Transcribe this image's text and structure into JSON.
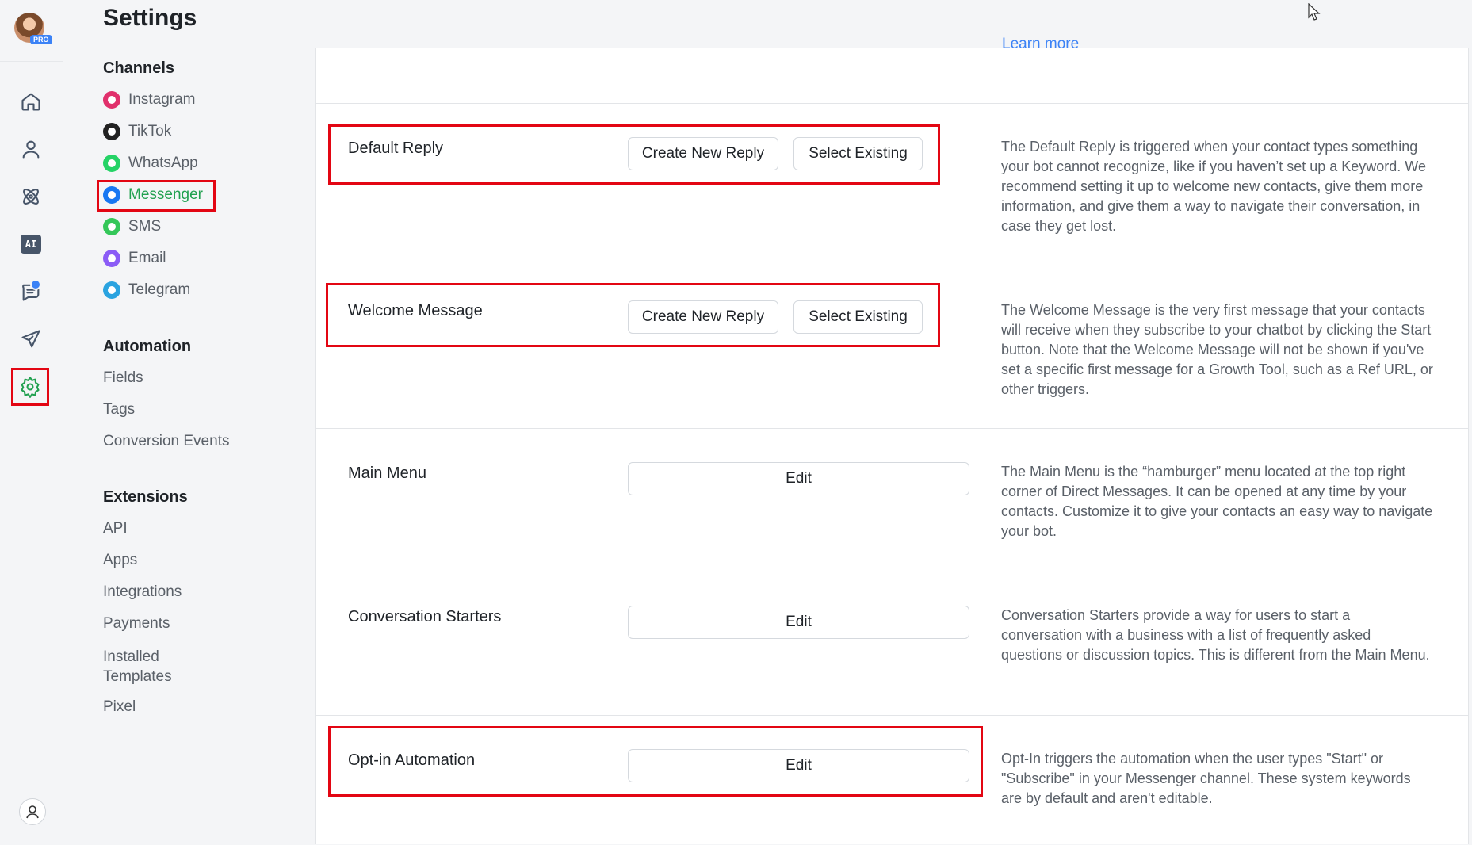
{
  "header": {
    "title": "Settings"
  },
  "rail": {
    "badge": "PRO",
    "ai_label": "AI",
    "items": [
      "home-icon",
      "contacts-icon",
      "automation-icon",
      "ai-icon",
      "chat-icon",
      "broadcast-icon",
      "settings-icon"
    ],
    "accent": "#22a150",
    "highlight": "#e30613"
  },
  "sidebar": {
    "channels_title": "Channels",
    "channels": [
      {
        "label": "Instagram",
        "color": "#e1306c"
      },
      {
        "label": "TikTok",
        "color": "#222222"
      },
      {
        "label": "WhatsApp",
        "color": "#25d366"
      },
      {
        "label": "Messenger",
        "color": "#1877f2",
        "active": true
      },
      {
        "label": "SMS",
        "color": "#34c759"
      },
      {
        "label": "Email",
        "color": "#8b5cf6"
      },
      {
        "label": "Telegram",
        "color": "#2aa3e0"
      }
    ],
    "automation_title": "Automation",
    "automation": [
      "Fields",
      "Tags",
      "Conversion Events"
    ],
    "extensions_title": "Extensions",
    "extensions": [
      "API",
      "Apps",
      "Integrations",
      "Payments",
      "Installed Templates",
      "Pixel"
    ]
  },
  "main": {
    "learn_more": "Learn more",
    "sections": [
      {
        "label": "Default Reply",
        "create_label": "Create New Reply",
        "select_label": "Select Existing",
        "desc": "The Default Reply is triggered when your contact types something your bot cannot recognize, like if you haven’t set up a Keyword. We recommend setting it up to welcome new contacts, give them more information, and give them a way to navigate their conversation, in case they get lost."
      },
      {
        "label": "Welcome Message",
        "create_label": "Create New Reply",
        "select_label": "Select Existing",
        "desc": "The Welcome Message is the very first message that your contacts will receive when they subscribe to your chatbot by clicking the Start button. Note that the Welcome Message will not be shown if you've set a specific first message for a Growth Tool, such as a Ref URL, or other triggers."
      },
      {
        "label": "Main Menu",
        "edit_label": "Edit",
        "desc": "The Main Menu is the “hamburger” menu located at the top right corner of Direct Messages. It can be opened at any time by your contacts. Customize it to give your contacts an easy way to navigate your bot."
      },
      {
        "label": "Conversation Starters",
        "edit_label": "Edit",
        "desc": "Conversation Starters provide a way for users to start a conversation with a business with a list of frequently asked questions or discussion topics. This is different from the Main Menu."
      },
      {
        "label": "Opt-in Automation",
        "edit_label": "Edit",
        "desc": "Opt-In triggers the automation when the user types \"Start\" or \"Subscribe\" in your Messenger channel. These system keywords are by default and aren't editable."
      }
    ]
  }
}
